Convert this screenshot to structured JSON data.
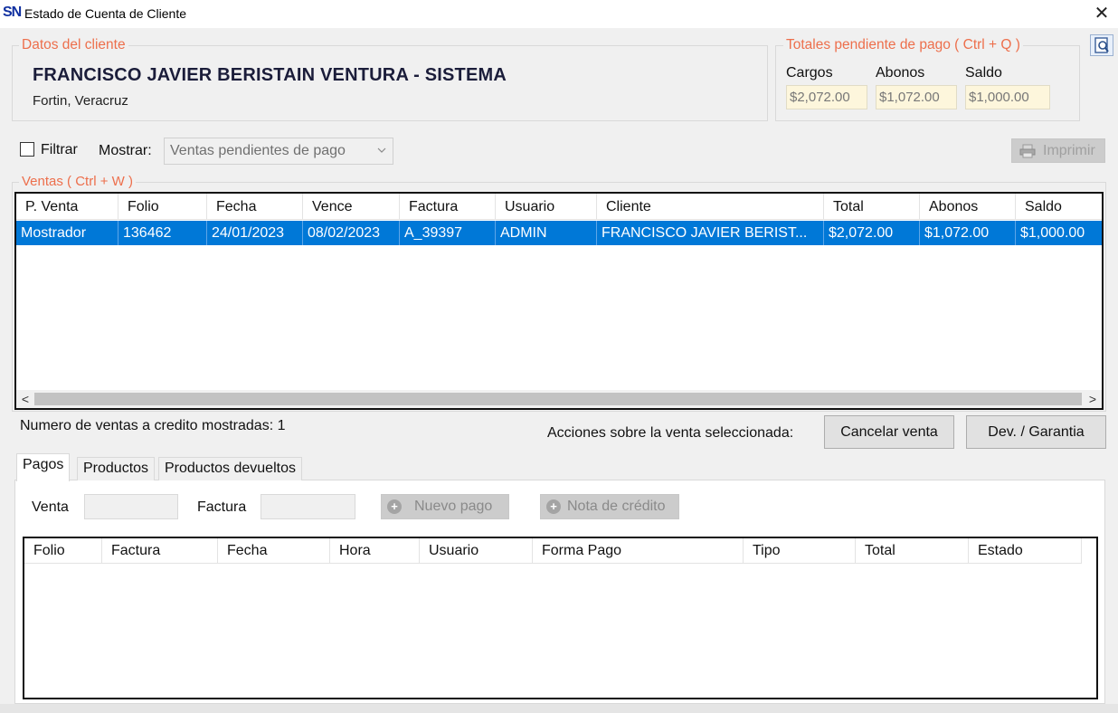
{
  "window": {
    "logo": "SN",
    "title": "Estado de Cuenta de Cliente"
  },
  "client": {
    "legend": "Datos del cliente",
    "name": "FRANCISCO JAVIER BERISTAIN VENTURA - SISTEMA",
    "location": "Fortin, Veracruz"
  },
  "totals": {
    "legend": "Totales pendiente de pago ( Ctrl + Q )",
    "cargos_label": "Cargos",
    "cargos": "$2,072.00",
    "abonos_label": "Abonos",
    "abonos": "$1,072.00",
    "saldo_label": "Saldo",
    "saldo": "$1,000.00"
  },
  "filter": {
    "checkbox_label": "Filtrar",
    "show_label": "Mostrar:",
    "show_value": "Ventas pendientes de pago",
    "print_label": "Imprimir"
  },
  "ventas": {
    "legend": "Ventas ( Ctrl + W )",
    "columns": [
      "P. Venta",
      "Folio",
      "Fecha",
      "Vence",
      "Factura",
      "Usuario",
      "Cliente",
      "Total",
      "Abonos",
      "Saldo"
    ],
    "rows": [
      [
        "Mostrador",
        "136462",
        "24/01/2023",
        "08/02/2023",
        "A_39397",
        "ADMIN",
        "FRANCISCO JAVIER BERIST...",
        "$2,072.00",
        "$1,072.00",
        "$1,000.00"
      ]
    ],
    "count_text": "Numero de ventas a credito mostradas: 1",
    "actions_label": "Acciones sobre la venta seleccionada:",
    "cancel_label": "Cancelar venta",
    "dev_label": "Dev. / Garantia"
  },
  "tabs": [
    "Pagos",
    "Productos",
    "Productos devueltos"
  ],
  "pagos": {
    "venta_label": "Venta",
    "factura_label": "Factura",
    "nuevo_pago_label": "Nuevo pago",
    "nota_credito_label": "Nota de crédito",
    "columns": [
      "Folio",
      "Factura",
      "Fecha",
      "Hora",
      "Usuario",
      "Forma Pago",
      "Tipo",
      "Total",
      "Estado"
    ]
  },
  "colors": {
    "accent": "#0078d7",
    "legend": "#ed6f4c",
    "readonly_bg": "#fdf6dc"
  }
}
